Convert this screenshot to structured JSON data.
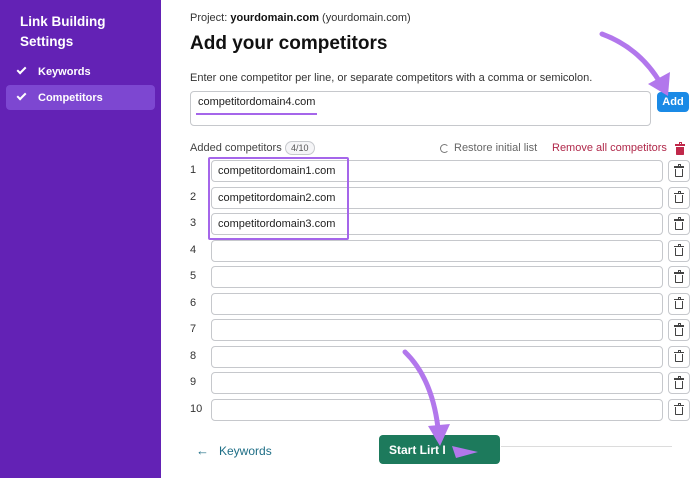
{
  "sidebar": {
    "title": "Link Building Settings",
    "items": [
      {
        "label": "Keywords",
        "active": false
      },
      {
        "label": "Competitors",
        "active": true
      }
    ]
  },
  "header": {
    "project_prefix": "Project:",
    "project_domain": "yourdomain.com",
    "project_suffix": "(yourdomain.com)",
    "title": "Add your competitors"
  },
  "input": {
    "instructions": "Enter one competitor per line, or separate competitors with a comma or semicolon.",
    "value": "competitordomain4.com",
    "add_label": "Add"
  },
  "added": {
    "label": "Added competitors",
    "count": "4/10",
    "restore_label": "Restore initial list",
    "remove_all_label": "Remove all competitors"
  },
  "rows": [
    {
      "num": "1",
      "value": "competitordomain1.com"
    },
    {
      "num": "2",
      "value": "competitordomain2.com"
    },
    {
      "num": "3",
      "value": "competitordomain3.com"
    },
    {
      "num": "4",
      "value": ""
    },
    {
      "num": "5",
      "value": ""
    },
    {
      "num": "6",
      "value": ""
    },
    {
      "num": "7",
      "value": ""
    },
    {
      "num": "8",
      "value": ""
    },
    {
      "num": "9",
      "value": ""
    },
    {
      "num": "10",
      "value": ""
    }
  ],
  "footer": {
    "back_label": "Keywords",
    "start_label": "Start Lirt I"
  },
  "colors": {
    "sidebar_bg": "#6322b5",
    "sidebar_active": "#7d47d1",
    "accent_purple": "#a566ea",
    "add_button": "#1a8ae6",
    "start_button": "#1d7a5c",
    "remove_red": "#b0284a",
    "link_teal": "#1e6e86"
  }
}
